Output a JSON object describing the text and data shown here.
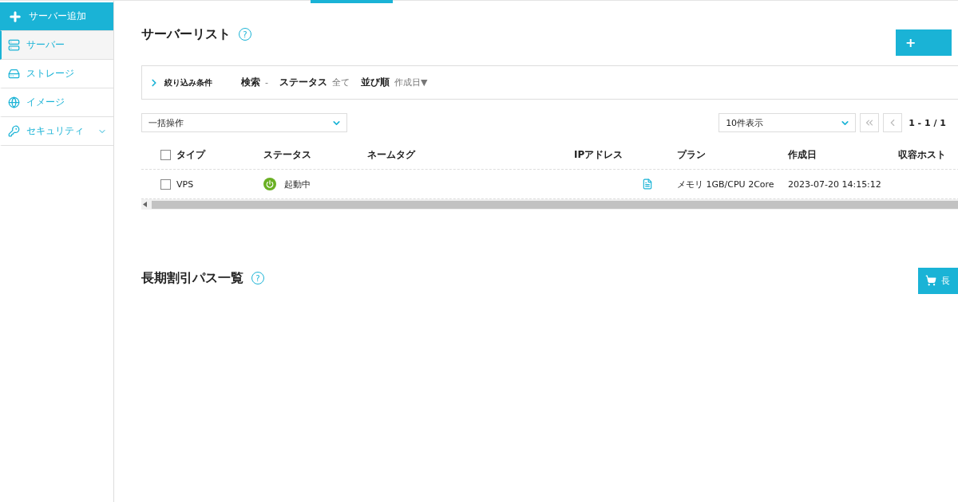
{
  "sidebar": {
    "items": [
      {
        "kind": "add",
        "label": "サーバー追加"
      },
      {
        "kind": "server",
        "label": "サーバー",
        "selected": true
      },
      {
        "kind": "storage",
        "label": "ストレージ",
        "selected": false
      },
      {
        "kind": "image",
        "label": "イメージ",
        "selected": false
      },
      {
        "kind": "security",
        "label": "セキュリティ",
        "selected": false,
        "expanded": false
      }
    ]
  },
  "server_list": {
    "title": "サーバーリスト",
    "help": "?",
    "add_button": "+",
    "filter": {
      "label": "絞り込み条件",
      "expanded": false,
      "fields": [
        {
          "name": "検索",
          "value": "-"
        },
        {
          "name": "ステータス",
          "value": "全て"
        },
        {
          "name": "並び順",
          "value": "作成日▼"
        }
      ]
    },
    "bulk_action": {
      "value": "一括操作"
    },
    "per_page": {
      "value": "10件表示"
    },
    "pagination": {
      "range": "1 - 1 / 1"
    },
    "table": {
      "columns": [
        "タイプ",
        "ステータス",
        "ネームタグ",
        "IPアドレス",
        "プラン",
        "作成日",
        "収容ホスト"
      ],
      "header_checked": false,
      "rows": [
        {
          "checked": false,
          "type": "VPS",
          "status": "起動中",
          "running": true,
          "plan": "メモリ 1GB/CPU 2Core",
          "created": "2023-07-20 14:15:12"
        }
      ]
    }
  },
  "discount_pass": {
    "title": "長期割引パス一覧",
    "help": "?",
    "button": "長"
  }
}
